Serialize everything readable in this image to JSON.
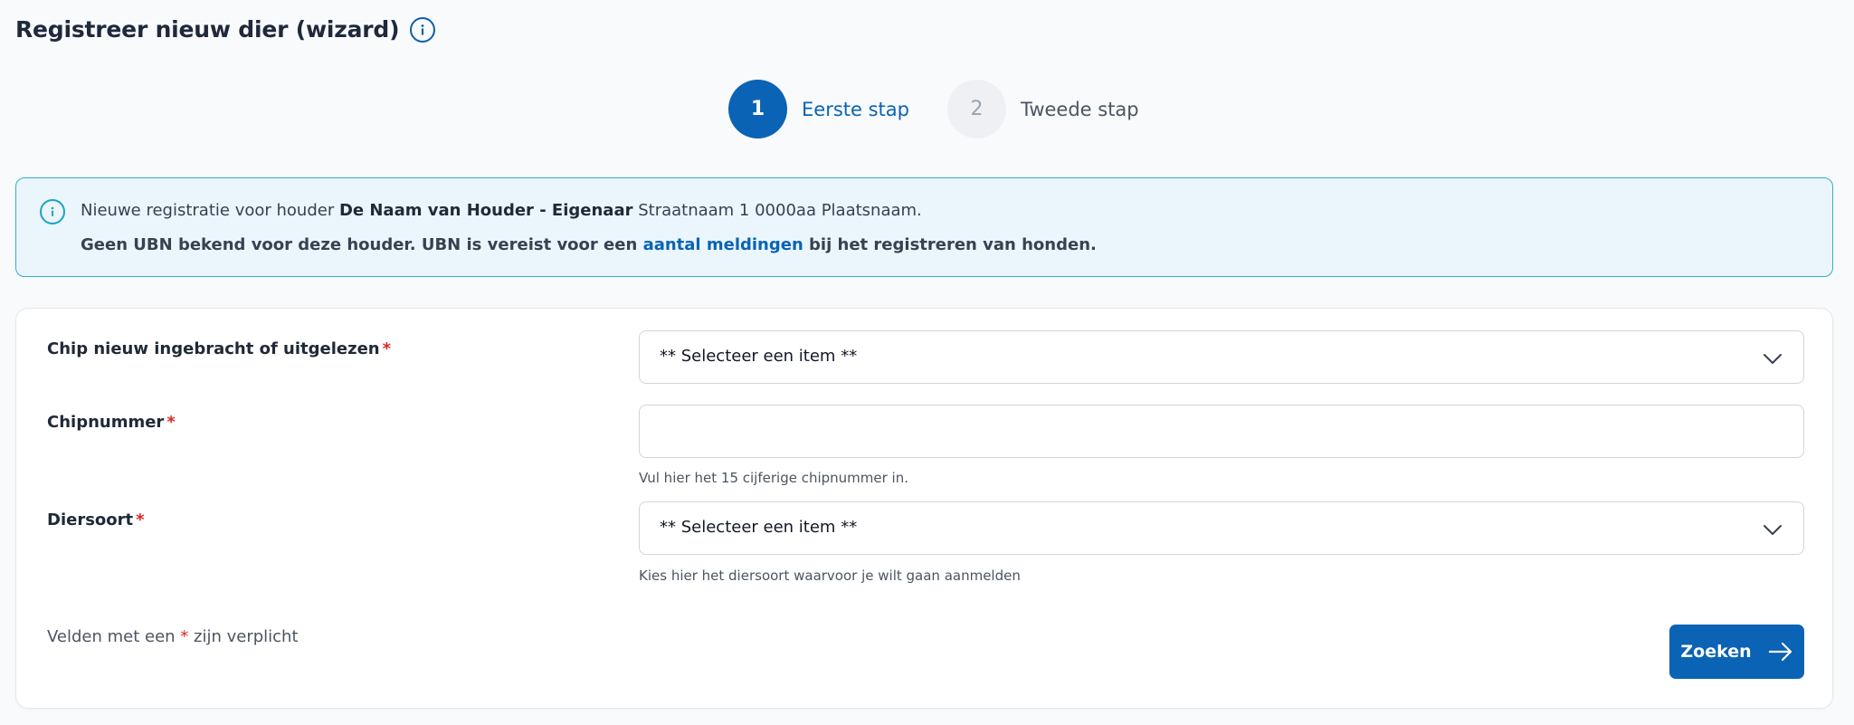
{
  "header": {
    "title": "Registreer nieuw dier (wizard)"
  },
  "stepper": {
    "steps": [
      {
        "number": "1",
        "label": "Eerste stap",
        "active": true
      },
      {
        "number": "2",
        "label": "Tweede stap",
        "active": false
      }
    ]
  },
  "alert": {
    "line1_prefix": "Nieuwe registratie voor houder ",
    "holder_name": "De Naam van Houder - Eigenaar",
    "address": " Straatnaam 1 0000aa Plaatsnaam.",
    "line2_prefix": "Geen UBN bekend voor deze houder. UBN is vereist voor een ",
    "link_text": "aantal meldingen",
    "line2_suffix": " bij het registreren van honden."
  },
  "form": {
    "chip_method": {
      "label": "Chip nieuw ingebracht of uitgelezen",
      "required_mark": "*",
      "value": "** Selecteer een item **"
    },
    "chipnumber": {
      "label": "Chipnummer",
      "required_mark": "*",
      "value": "",
      "helper": "Vul hier het 15 cijferige chipnummer in."
    },
    "species": {
      "label": "Diersoort",
      "required_mark": "*",
      "value": "** Selecteer een item **",
      "helper": "Kies hier het diersoort waarvoor je wilt gaan aanmelden"
    },
    "required_note_prefix": "Velden met een ",
    "required_note_star": "*",
    "required_note_suffix": " zijn verplicht",
    "search_button": "Zoeken"
  },
  "colors": {
    "primary": "#0a63b5",
    "alert_border": "#36aecb",
    "alert_bg": "#eaf6fb",
    "required": "#dc2626"
  }
}
